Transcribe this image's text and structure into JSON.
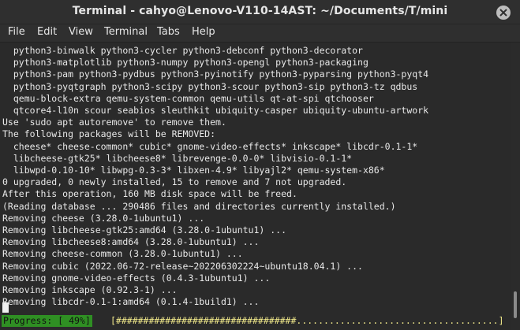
{
  "window": {
    "title": "Terminal - cahyo@Lenovo-V110-14AST: ~/Documents/T/mini"
  },
  "menu": [
    "File",
    "Edit",
    "View",
    "Terminal",
    "Tabs",
    "Help"
  ],
  "lines": [
    "  python3-binwalk python3-cycler python3-debconf python3-decorator",
    "  python3-matplotlib python3-numpy python3-opengl python3-packaging",
    "  python3-pam python3-pydbus python3-pyinotify python3-pyparsing python3-pyqt4",
    "  python3-pyqtgraph python3-scipy python3-scour python3-sip python3-tz qdbus",
    "  qemu-block-extra qemu-system-common qemu-utils qt-at-spi qtchooser",
    "  qtcore4-l10n scour seabios sleuthkit ubiquity-casper ubiquity-ubuntu-artwork",
    "Use 'sudo apt autoremove' to remove them.",
    "The following packages will be REMOVED:",
    "  cheese* cheese-common* cubic* gnome-video-effects* inkscape* libcdr-0.1-1*",
    "  libcheese-gtk25* libcheese8* librevenge-0.0-0* libvisio-0.1-1*",
    "  libwpd-0.10-10* libwpg-0.3-3* libxen-4.9* libyajl2* qemu-system-x86*",
    "0 upgraded, 0 newly installed, 15 to remove and 7 not upgraded.",
    "After this operation, 160 MB disk space will be freed.",
    "(Reading database ... 290486 files and directories currently installed.)",
    "Removing cheese (3.28.0-1ubuntu1) ...",
    "Removing libcheese-gtk25:amd64 (3.28.0-1ubuntu1) ...",
    "Removing libcheese8:amd64 (3.28.0-1ubuntu1) ...",
    "Removing cheese-common (3.28.0-1ubuntu1) ...",
    "Removing cubic (2022.06-72-release~202206302224~ubuntu18.04.1) ...",
    "Removing gnome-video-effects (0.4.3-1ubuntu1) ...",
    "Removing inkscape (0.92.3-1) ...",
    "Removing libcdr-0.1-1:amd64 (0.1.4-1build1) ..."
  ],
  "progress": {
    "label": "Progress: [ 49%]",
    "bar": "[#################################.....................................]"
  }
}
